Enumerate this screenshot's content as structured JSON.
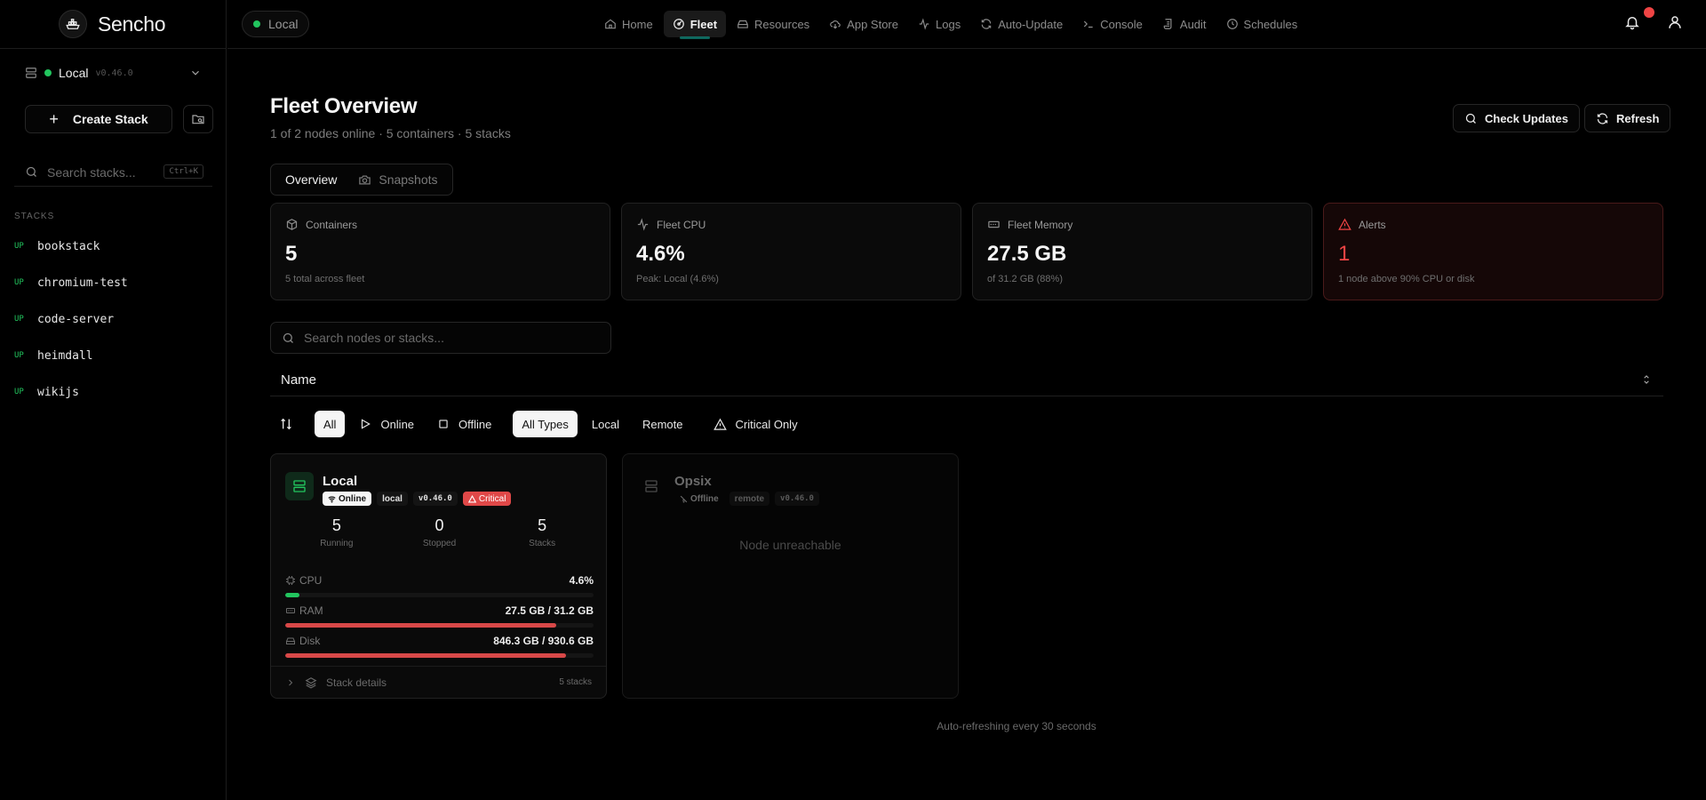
{
  "app": {
    "name": "Sencho"
  },
  "sidebar": {
    "node": {
      "name": "Local",
      "version": "v0.46.0"
    },
    "create_label": "Create Stack",
    "search_placeholder": "Search stacks...",
    "search_shortcut": "Ctrl+K",
    "section_label": "STACKS",
    "stacks": [
      {
        "status": "UP",
        "name": "bookstack"
      },
      {
        "status": "UP",
        "name": "chromium-test"
      },
      {
        "status": "UP",
        "name": "code-server"
      },
      {
        "status": "UP",
        "name": "heimdall"
      },
      {
        "status": "UP",
        "name": "wikijs"
      }
    ]
  },
  "topbar": {
    "node_chip": "Local",
    "nav": [
      {
        "label": "Home",
        "icon": "home-icon"
      },
      {
        "label": "Fleet",
        "icon": "fleet-icon",
        "active": true
      },
      {
        "label": "Resources",
        "icon": "drive-icon"
      },
      {
        "label": "App Store",
        "icon": "cloud-download-icon"
      },
      {
        "label": "Logs",
        "icon": "activity-icon"
      },
      {
        "label": "Auto-Update",
        "icon": "refresh-icon"
      },
      {
        "label": "Console",
        "icon": "terminal-icon"
      },
      {
        "label": "Audit",
        "icon": "scroll-icon"
      },
      {
        "label": "Schedules",
        "icon": "clock-icon"
      }
    ]
  },
  "page": {
    "title": "Fleet Overview",
    "subtitle": "1 of 2 nodes online · 5 containers · 5 stacks",
    "check_updates_label": "Check Updates",
    "refresh_label": "Refresh",
    "tabs": [
      {
        "label": "Overview",
        "active": true
      },
      {
        "label": "Snapshots"
      }
    ]
  },
  "stats": {
    "containers": {
      "label": "Containers",
      "value": "5",
      "note": "5 total across fleet"
    },
    "cpu": {
      "label": "Fleet CPU",
      "value": "4.6%",
      "note": "Peak: Local (4.6%)"
    },
    "memory": {
      "label": "Fleet Memory",
      "value": "27.5 GB",
      "note": "of 31.2 GB (88%)"
    },
    "alerts": {
      "label": "Alerts",
      "value": "1",
      "note": "1 node above 90% CPU or disk"
    }
  },
  "filters": {
    "search_placeholder": "Search nodes or stacks...",
    "sort_value": "Name",
    "status": [
      "All",
      "Online",
      "Offline"
    ],
    "types": [
      "All Types",
      "Local",
      "Remote"
    ],
    "critical_label": "Critical Only"
  },
  "nodes": [
    {
      "name": "Local",
      "status": "Online",
      "type": "local",
      "version": "v0.46.0",
      "alert": "Critical",
      "running": "5",
      "running_label": "Running",
      "stopped": "0",
      "stopped_label": "Stopped",
      "stacks": "5",
      "stacks_label": "Stacks",
      "cpu_label": "CPU",
      "cpu_value": "4.6%",
      "cpu_pct": 4.6,
      "ram_label": "RAM",
      "ram_value": "27.5 GB / 31.2 GB",
      "ram_pct": 88,
      "disk_label": "Disk",
      "disk_value": "846.3 GB / 930.6 GB",
      "disk_pct": 91,
      "footer_label": "Stack details",
      "footer_count": "5 stacks"
    },
    {
      "name": "Opsix",
      "status": "Offline",
      "type": "remote",
      "version": "v0.46.0",
      "message": "Node unreachable"
    }
  ],
  "footer": {
    "auto_refresh": "Auto-refreshing every 30 seconds"
  },
  "colors": {
    "accent_green": "#22c55e",
    "critical_red": "#ef4444",
    "ram_bar": "#d94848"
  }
}
